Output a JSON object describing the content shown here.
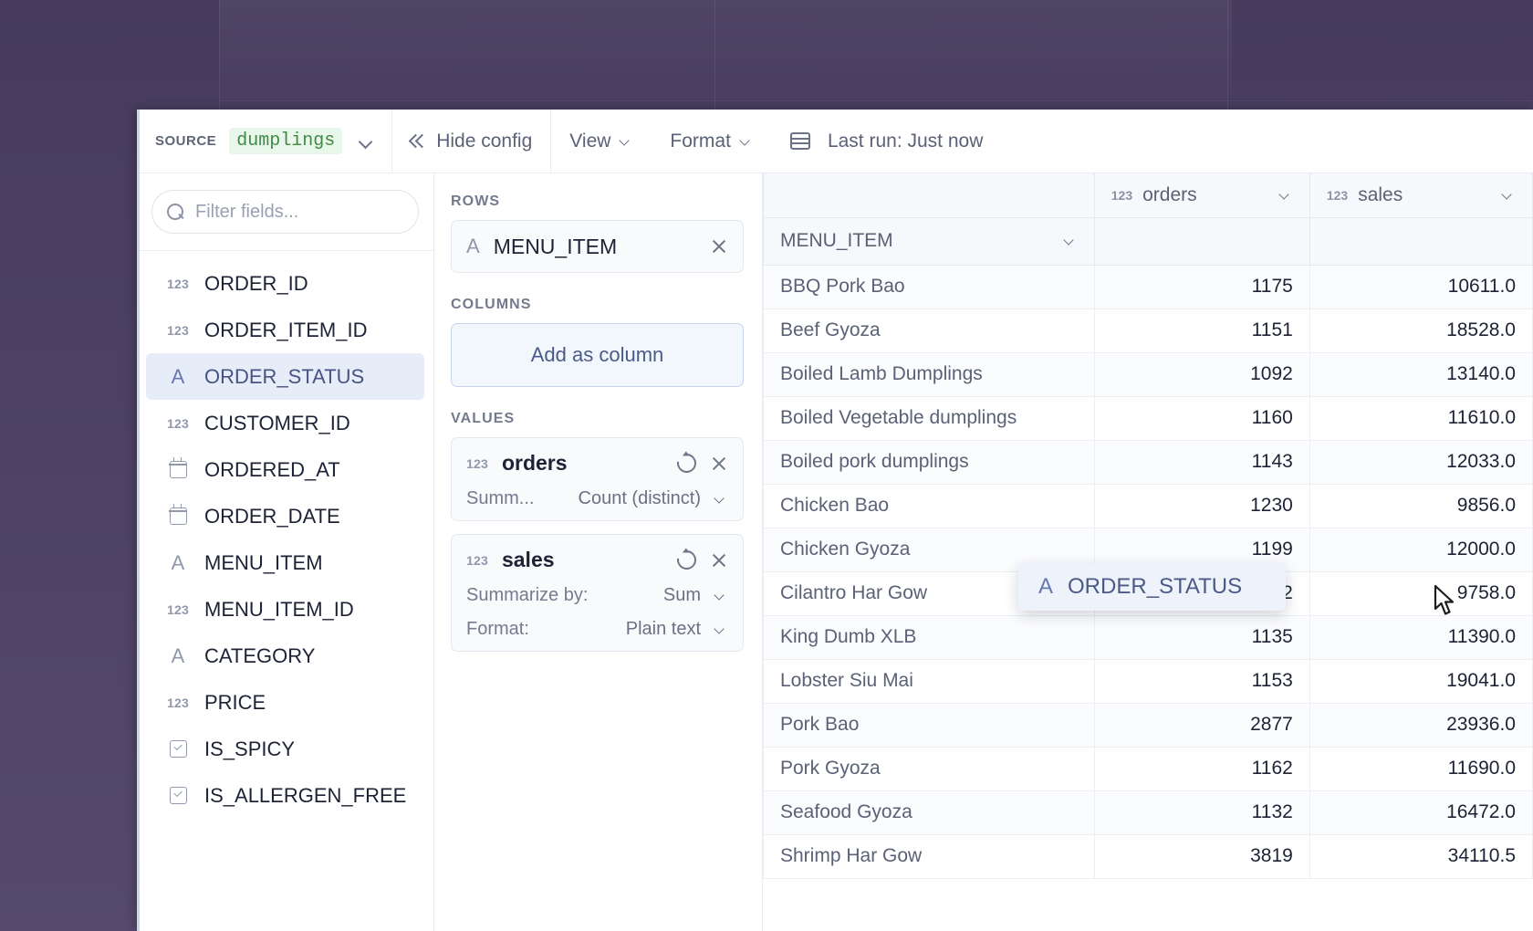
{
  "toolbar": {
    "source_label": "SOURCE",
    "source_value": "dumplings",
    "hide_config": "Hide config",
    "view": "View",
    "format": "Format",
    "last_run": "Last run: Just now"
  },
  "sidebar": {
    "filter_placeholder": "Filter fields...",
    "fields": [
      {
        "name": "ORDER_ID",
        "type": "number",
        "selected": false
      },
      {
        "name": "ORDER_ITEM_ID",
        "type": "number",
        "selected": false
      },
      {
        "name": "ORDER_STATUS",
        "type": "text",
        "selected": true
      },
      {
        "name": "CUSTOMER_ID",
        "type": "number",
        "selected": false
      },
      {
        "name": "ORDERED_AT",
        "type": "date",
        "selected": false
      },
      {
        "name": "ORDER_DATE",
        "type": "date",
        "selected": false
      },
      {
        "name": "MENU_ITEM",
        "type": "text",
        "selected": false
      },
      {
        "name": "MENU_ITEM_ID",
        "type": "number",
        "selected": false
      },
      {
        "name": "CATEGORY",
        "type": "text",
        "selected": false
      },
      {
        "name": "PRICE",
        "type": "number",
        "selected": false
      },
      {
        "name": "IS_SPICY",
        "type": "boolean",
        "selected": false
      },
      {
        "name": "IS_ALLERGEN_FREE",
        "type": "boolean",
        "selected": false
      }
    ]
  },
  "config": {
    "rows_label": "ROWS",
    "rows_field": "MENU_ITEM",
    "columns_label": "COLUMNS",
    "add_as_column": "Add as column",
    "values_label": "VALUES",
    "values": [
      {
        "name": "orders",
        "summarize_label": "Summ...",
        "summarize_value": "Count (distinct)",
        "has_format": false
      },
      {
        "name": "sales",
        "summarize_label": "Summarize by:",
        "summarize_value": "Sum",
        "has_format": true,
        "format_label": "Format:",
        "format_value": "Plain text"
      }
    ]
  },
  "drag": {
    "field": "ORDER_STATUS"
  },
  "table": {
    "row_header": "MENU_ITEM",
    "columns": [
      {
        "name": "orders",
        "type": "number"
      },
      {
        "name": "sales",
        "type": "number"
      }
    ],
    "rows": [
      {
        "item": "BBQ Pork Bao",
        "orders": "1175",
        "sales": "10611.0"
      },
      {
        "item": "Beef Gyoza",
        "orders": "1151",
        "sales": "18528.0"
      },
      {
        "item": "Boiled Lamb Dumplings",
        "orders": "1092",
        "sales": "13140.0"
      },
      {
        "item": "Boiled Vegetable dumplings",
        "orders": "1160",
        "sales": "11610.0"
      },
      {
        "item": "Boiled pork dumplings",
        "orders": "1143",
        "sales": "12033.0"
      },
      {
        "item": "Chicken Bao",
        "orders": "1230",
        "sales": "9856.0"
      },
      {
        "item": "Chicken Gyoza",
        "orders": "1199",
        "sales": "12000.0"
      },
      {
        "item": "Cilantro Har Gow",
        "orders": "1142",
        "sales": "9758.0"
      },
      {
        "item": "King Dumb XLB",
        "orders": "1135",
        "sales": "11390.0"
      },
      {
        "item": "Lobster Siu Mai",
        "orders": "1153",
        "sales": "19041.0"
      },
      {
        "item": "Pork Bao",
        "orders": "2877",
        "sales": "23936.0"
      },
      {
        "item": "Pork Gyoza",
        "orders": "1162",
        "sales": "11690.0"
      },
      {
        "item": "Seafood Gyoza",
        "orders": "1132",
        "sales": "16472.0"
      },
      {
        "item": "Shrimp Har Gow",
        "orders": "3819",
        "sales": "34110.5"
      }
    ]
  },
  "colors": {
    "desktop": "#4e4367",
    "accent": "#4b5a87",
    "source_chip_text": "#3f8a46",
    "source_chip_bg": "#e9f6ea",
    "selection_bg": "#e7ecf9"
  }
}
